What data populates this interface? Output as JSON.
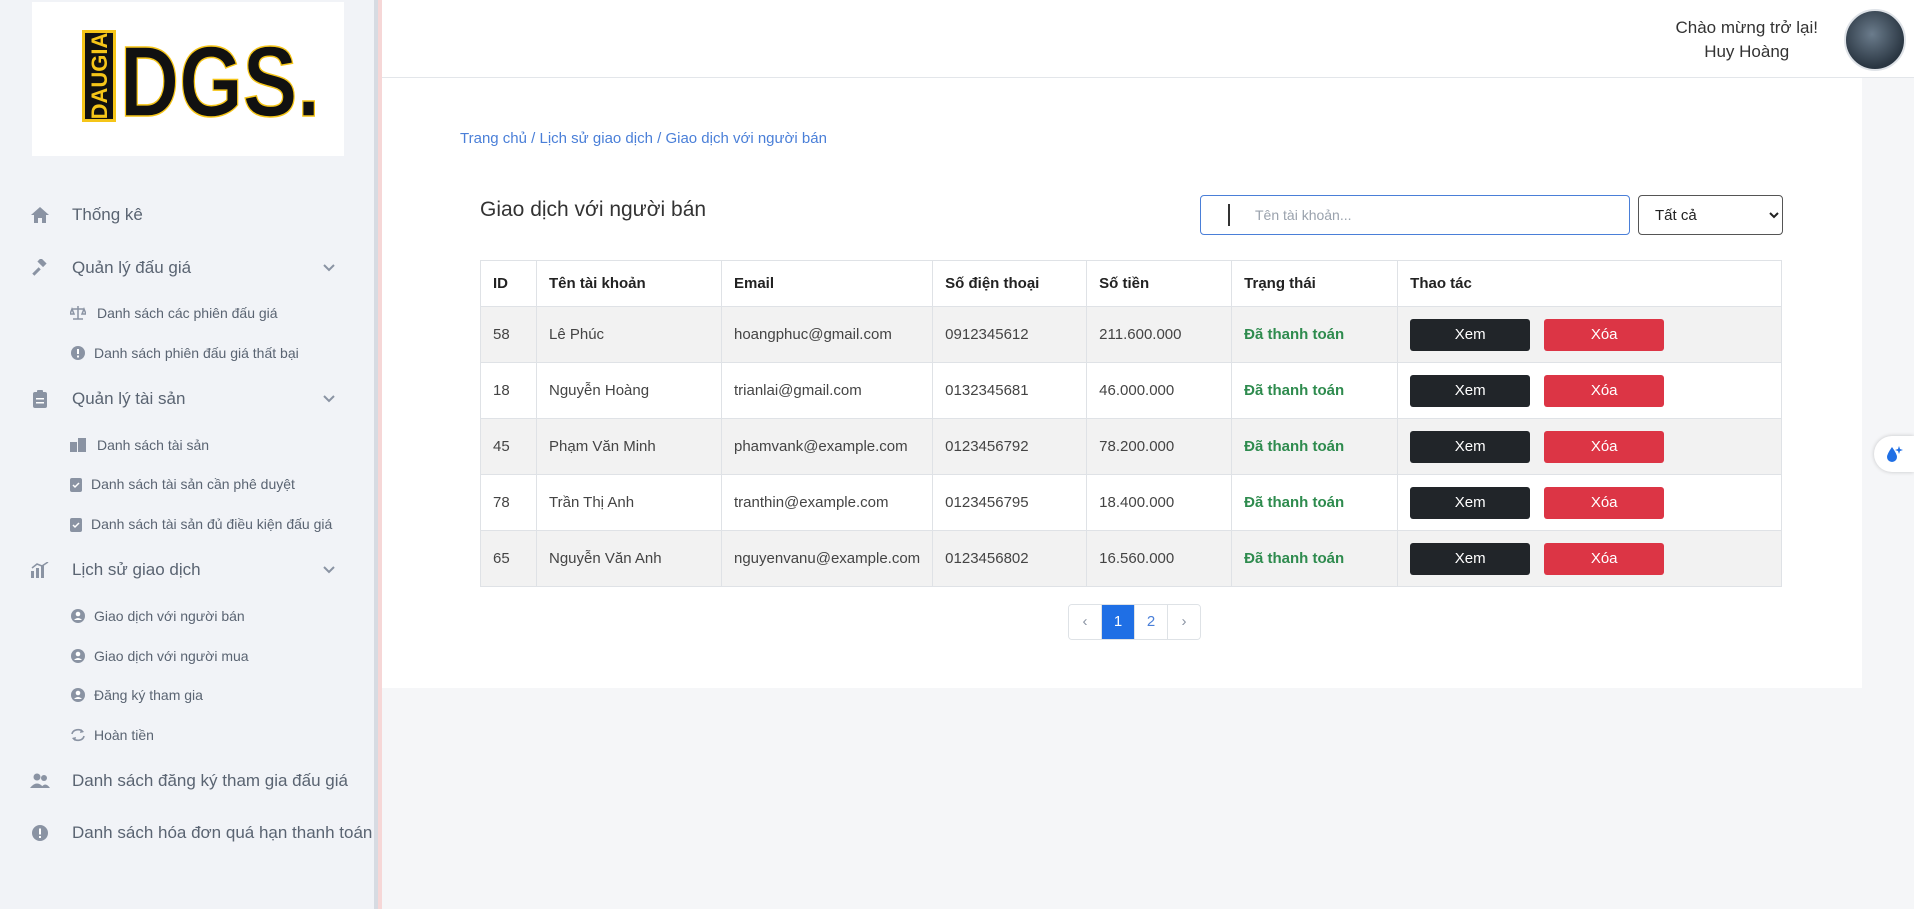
{
  "logo": {
    "text_vertical": "DAUGIA",
    "text_main": "DGS."
  },
  "header": {
    "greeting": "Chào mừng trở lại!",
    "user_name": "Huy Hoàng"
  },
  "sidebar": {
    "items": [
      {
        "label": "Thống kê",
        "icon": "home-icon"
      },
      {
        "label": "Quản lý đấu giá",
        "icon": "gavel-icon",
        "children": [
          {
            "label": "Danh sách các phiên đấu giá",
            "icon": "scale-icon"
          },
          {
            "label": "Danh sách phiên đấu giá thất bại",
            "icon": "alert-circle-icon"
          }
        ]
      },
      {
        "label": "Quản lý tài sản",
        "icon": "clipboard-icon",
        "children": [
          {
            "label": "Danh sách tài sản",
            "icon": "buildings-icon"
          },
          {
            "label": "Danh sách tài sản cần phê duyệt",
            "icon": "doc-check-icon"
          },
          {
            "label": "Danh sách tài sản đủ điều kiện đấu giá",
            "icon": "doc-check-icon"
          }
        ]
      },
      {
        "label": "Lịch sử giao dịch",
        "icon": "chart-icon",
        "children": [
          {
            "label": "Giao dịch với người bán",
            "icon": "user-badge-icon"
          },
          {
            "label": "Giao dịch với người mua",
            "icon": "user-badge-icon"
          },
          {
            "label": "Đăng ký tham gia",
            "icon": "user-badge-icon"
          },
          {
            "label": "Hoàn tiền",
            "icon": "refresh-icon"
          }
        ]
      },
      {
        "label": "Danh sách đăng ký tham gia đấu giá",
        "icon": "users-icon"
      },
      {
        "label": "Danh sách hóa đơn quá hạn thanh toán",
        "icon": "alert-circle-icon"
      }
    ]
  },
  "breadcrumb": [
    "Trang chủ",
    "Lịch sử giao dịch",
    "Giao dịch với người bán"
  ],
  "breadcrumb_sep": " / ",
  "page_title": "Giao dịch với người bán",
  "search": {
    "placeholder": "Tên tài khoản...",
    "value": ""
  },
  "filter": {
    "selected": "Tất cả"
  },
  "table": {
    "headers": [
      "ID",
      "Tên tài khoản",
      "Email",
      "Số điện thoại",
      "Số tiền",
      "Trạng thái",
      "Thao tác"
    ],
    "rows": [
      {
        "id": "58",
        "name": "Lê Phúc",
        "email": "hoangphuc@gmail.com",
        "phone": "0912345612",
        "amount": "211.600.000",
        "status": "Đã thanh toán"
      },
      {
        "id": "18",
        "name": "Nguyễn Hoàng",
        "email": "trianlai@gmail.com",
        "phone": "0132345681",
        "amount": "46.000.000",
        "status": "Đã thanh toán"
      },
      {
        "id": "45",
        "name": "Phạm Văn Minh",
        "email": "phamvank@example.com",
        "phone": "0123456792",
        "amount": "78.200.000",
        "status": "Đã thanh toán"
      },
      {
        "id": "78",
        "name": "Trần Thị Anh",
        "email": "tranthin@example.com",
        "phone": "0123456795",
        "amount": "18.400.000",
        "status": "Đã thanh toán"
      },
      {
        "id": "65",
        "name": "Nguyễn Văn Anh",
        "email": "nguyenvanu@example.com",
        "phone": "0123456802",
        "amount": "16.560.000",
        "status": "Đã thanh toán"
      }
    ],
    "view_label": "Xem",
    "delete_label": "Xóa"
  },
  "pagination": {
    "prev": "‹",
    "pages": [
      "1",
      "2"
    ],
    "active": "1",
    "next": "›"
  },
  "colors": {
    "accent": "#1f6fe5",
    "status_paid": "#2e8b4e",
    "danger": "#dc3545",
    "dark": "#212529"
  }
}
